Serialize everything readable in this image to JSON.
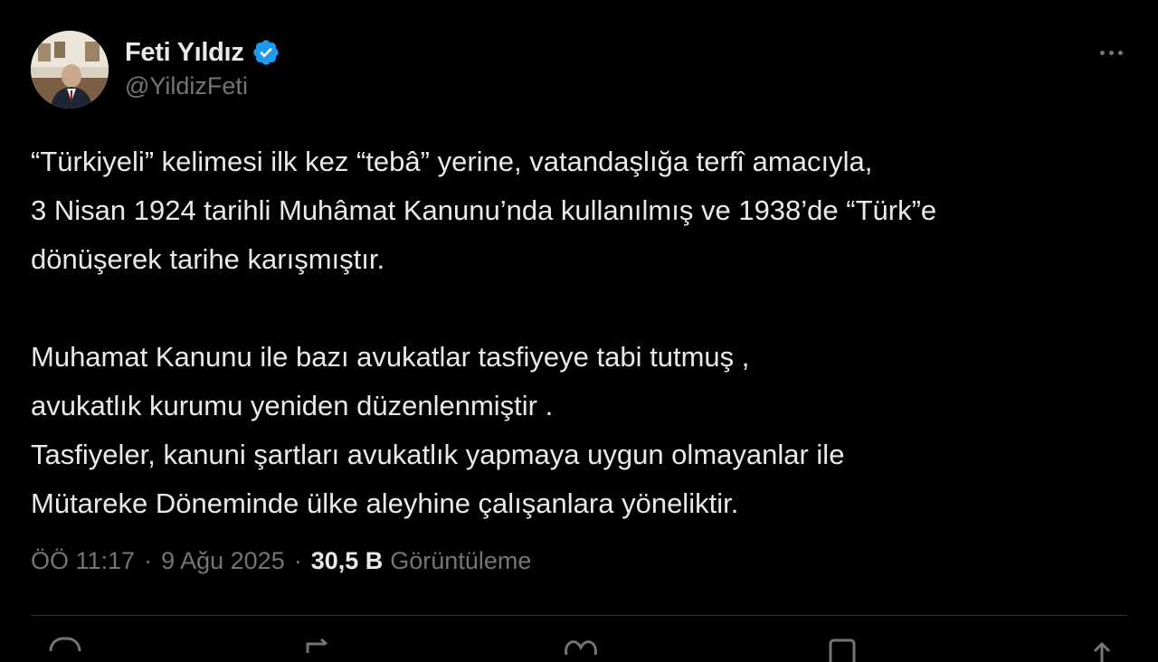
{
  "author": {
    "display_name": "Feti Yıldız",
    "handle": "@YildizFeti",
    "verified": true,
    "verified_color": "#1d9bf0"
  },
  "tweet": {
    "paragraph1": [
      "“Türkiyeli” kelimesi ilk kez “tebâ” yerine, vatandaşlığa terfî amacıyla,",
      "3 Nisan 1924 tarihli Muhâmat Kanunu’nda kullanılmış ve 1938’de “Türk”e",
      "dönüşerek tarihe karışmıştır."
    ],
    "paragraph2": [
      "Muhamat Kanunu ile bazı avukatlar tasfiyeye tabi tutmuş ,",
      "avukatlık kurumu yeniden düzenlenmiştir .",
      "Tasfiyeler, kanuni şartları avukatlık yapmaya uygun olmayanlar ile",
      "Mütareke Döneminde ülke aleyhine çalışanlara yöneliktir."
    ]
  },
  "meta": {
    "time": "ÖÖ 11:17",
    "separator": "·",
    "date": "9 Ağu 2025",
    "views_count": "30,5 B",
    "views_label": "Görüntüleme"
  },
  "icons": {
    "more": "more-horizontal-icon",
    "verified": "verified-badge-icon",
    "actions": [
      "reply-icon",
      "retweet-icon",
      "like-icon",
      "bookmark-icon",
      "share-icon"
    ]
  },
  "colors": {
    "background": "#000000",
    "text_primary": "#e7e9ea",
    "text_secondary": "#71767b",
    "divider": "#2f3336",
    "accent": "#1d9bf0"
  }
}
